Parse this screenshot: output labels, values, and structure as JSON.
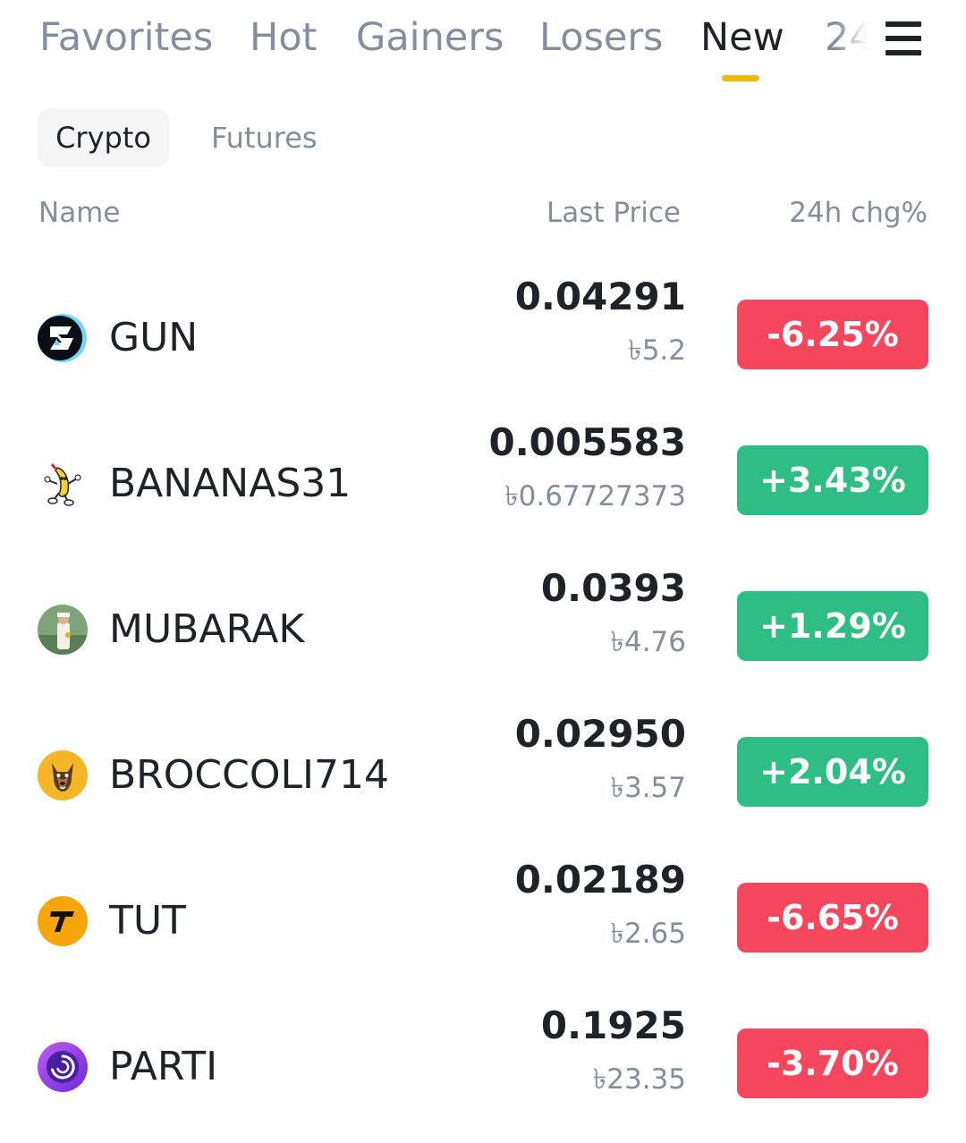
{
  "top_tabs": [
    "Favorites",
    "Hot",
    "Gainers",
    "Losers",
    "New",
    "24"
  ],
  "active_top_tab": "New",
  "sub_tabs": {
    "crypto": "Crypto",
    "futures": "Futures"
  },
  "columns": {
    "name": "Name",
    "last_price": "Last Price",
    "change": "24h chg%"
  },
  "colors": {
    "accent": "#f0b90b",
    "down": "#f6465d",
    "up": "#2ebd85",
    "muted": "#848e9c",
    "text": "#1e2329"
  },
  "rows": [
    {
      "symbol": "GUN",
      "price": "0.04291",
      "fiat": "৳5.2",
      "change": "-6.25%",
      "direction": "down",
      "icon": "gun-coin-icon"
    },
    {
      "symbol": "BANANAS31",
      "price": "0.005583",
      "fiat": "৳0.67727373",
      "change": "+3.43%",
      "direction": "up",
      "icon": "bananas31-coin-icon"
    },
    {
      "symbol": "MUBARAK",
      "price": "0.0393",
      "fiat": "৳4.76",
      "change": "+1.29%",
      "direction": "up",
      "icon": "mubarak-coin-icon"
    },
    {
      "symbol": "BROCCOLI714",
      "price": "0.02950",
      "fiat": "৳3.57",
      "change": "+2.04%",
      "direction": "up",
      "icon": "broccoli714-coin-icon"
    },
    {
      "symbol": "TUT",
      "price": "0.02189",
      "fiat": "৳2.65",
      "change": "-6.65%",
      "direction": "down",
      "icon": "tut-coin-icon"
    },
    {
      "symbol": "PARTI",
      "price": "0.1925",
      "fiat": "৳23.35",
      "change": "-3.70%",
      "direction": "down",
      "icon": "parti-coin-icon"
    }
  ]
}
